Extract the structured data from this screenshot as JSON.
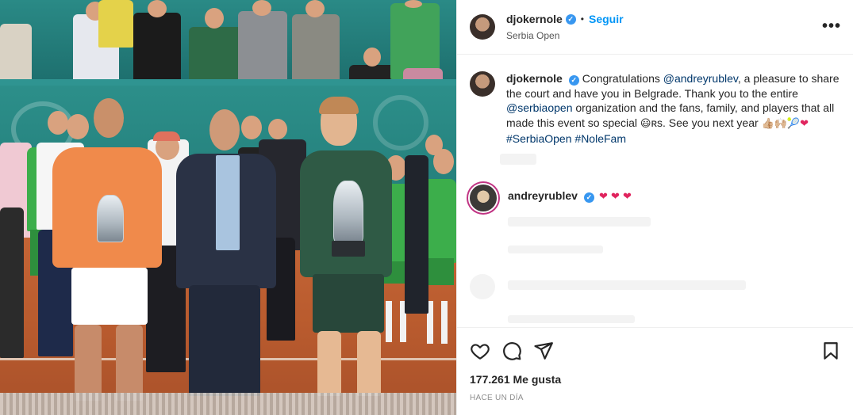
{
  "header": {
    "username": "djokernole",
    "follow_label": "Seguir",
    "separator": "•",
    "location": "Serbia Open",
    "more_label": "•••"
  },
  "caption": {
    "username": "djokernole",
    "text_1": "Congratulations ",
    "mention_1": "@andreyrublev",
    "text_2": ", a pleasure to share the court and have you in Belgrade. Thank you to the entire ",
    "mention_2": "@serbiaopen",
    "text_3": " organization and the fans, family, and players that all made this event so special ",
    "emoji_grin": "😃",
    "text_4": "ʀs. See you next year ",
    "emoji_tail": "👍🏼🙌🏼🎾",
    "emoji_heart": "❤",
    "hashtag_1": "#SerbiaOpen",
    "hashtag_2": "#NoleFam"
  },
  "comment": {
    "username": "andreyrublev",
    "hearts": "❤ ❤ ❤"
  },
  "actions": {
    "likes": "177.261 Me gusta",
    "time": "HACE UN DÍA"
  },
  "icons": [
    "heart-icon",
    "comment-icon",
    "share-icon",
    "bookmark-icon",
    "verified-badge-icon",
    "more-options-icon"
  ],
  "colors": {
    "follow": "#0095f6",
    "verified": "#3897f0",
    "link": "#00376b",
    "heart": "#e0245e"
  }
}
